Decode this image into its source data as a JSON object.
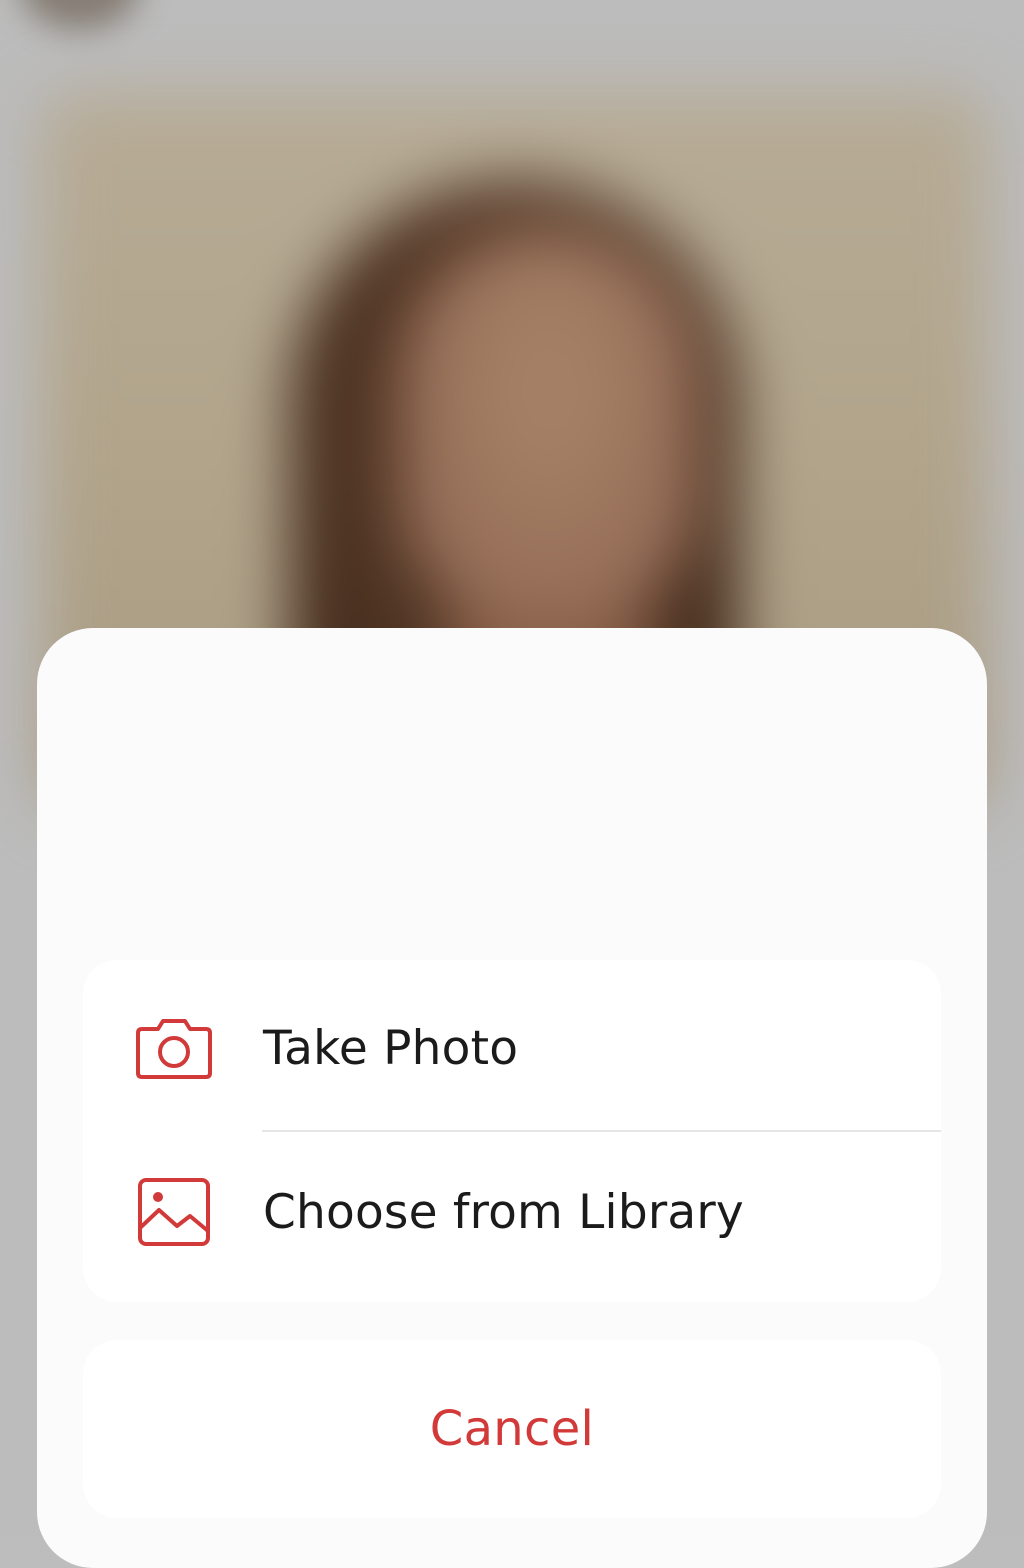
{
  "background": {
    "description_icon": "blurred-portrait-photo"
  },
  "sheet": {
    "options": [
      {
        "label": "Take Photo",
        "icon": "camera-icon"
      },
      {
        "label": "Choose from Library",
        "icon": "image-icon"
      }
    ],
    "cancel_label": "Cancel"
  },
  "colors": {
    "accent": "#d23a3a",
    "sheet_background": "#fbfbfb",
    "row_background": "#ffffff",
    "text": "#1b1b1b",
    "backdrop": "#bcbcbc"
  }
}
